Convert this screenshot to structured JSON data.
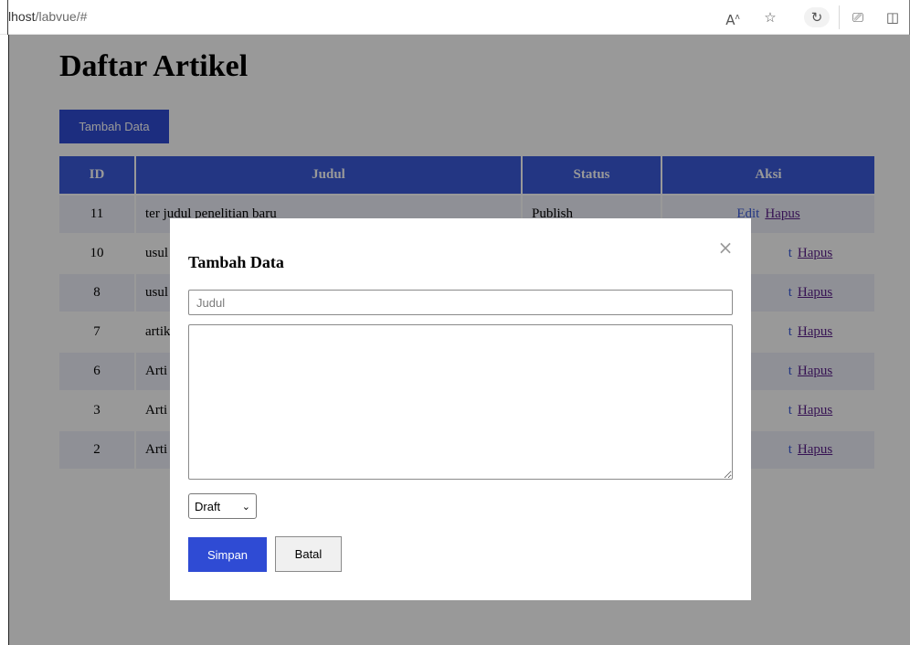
{
  "browser": {
    "url_host": "lhost",
    "url_rest": "/labvue/#"
  },
  "header": {
    "title": "Daftar Artikel",
    "add_button_label": "Tambah Data"
  },
  "table": {
    "columns": [
      "ID",
      "Judul",
      "Status",
      "Aksi"
    ],
    "rows": [
      {
        "id": "11",
        "judul": "ter judul penelitian baru",
        "status": "Publish"
      },
      {
        "id": "10",
        "judul": "usul",
        "status": ""
      },
      {
        "id": "8",
        "judul": "usul",
        "status": ""
      },
      {
        "id": "7",
        "judul": "artik",
        "status": ""
      },
      {
        "id": "6",
        "judul": "Arti",
        "status": ""
      },
      {
        "id": "3",
        "judul": "Arti",
        "status": ""
      },
      {
        "id": "2",
        "judul": "Arti",
        "status": ""
      }
    ],
    "action_edit_label": "Edit",
    "action_edit_partial": "t",
    "action_delete_label": "Hapus"
  },
  "modal": {
    "title": "Tambah Data",
    "close_symbol": "×",
    "judul_placeholder": "Judul",
    "status_value": "Draft",
    "save_label": "Simpan",
    "cancel_label": "Batal"
  },
  "colors": {
    "primary": "#2f4bd4",
    "table_header": "#3b5bdb"
  }
}
